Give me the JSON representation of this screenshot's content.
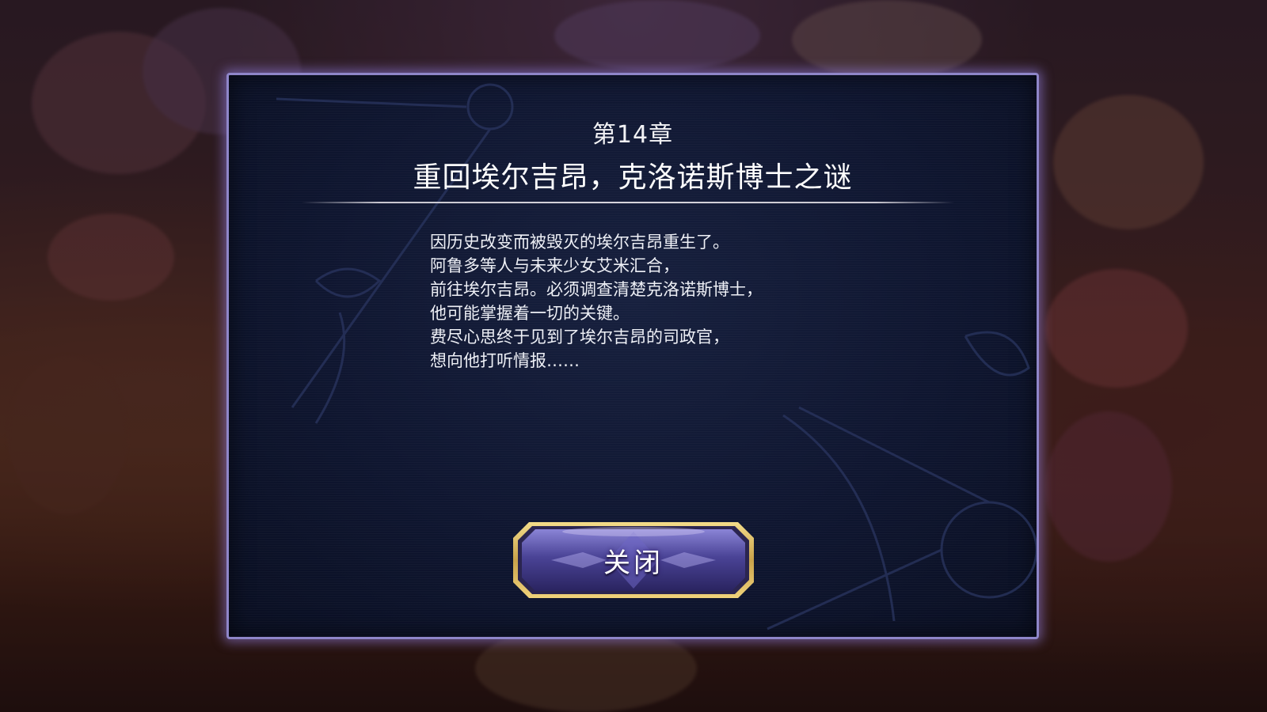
{
  "dialog": {
    "chapter": "第14章",
    "title": "重回埃尔吉昂，克洛诺斯博士之谜",
    "lines": [
      "因历史改变而被毁灭的埃尔吉昂重生了。",
      "阿鲁多等人与未来少女艾米汇合，",
      "前往埃尔吉昂。必须调查清楚克洛诺斯博士，",
      "他可能掌握着一切的关键。",
      "费尽心思终于见到了埃尔吉昂的司政官，",
      "想向他打听情报……"
    ],
    "close_label": "关闭"
  },
  "colors": {
    "frame_border": "#8f86c9",
    "panel_bg": "#0f1630",
    "button_gold": "#d4b35a",
    "button_purple": "#5a4fa8"
  }
}
